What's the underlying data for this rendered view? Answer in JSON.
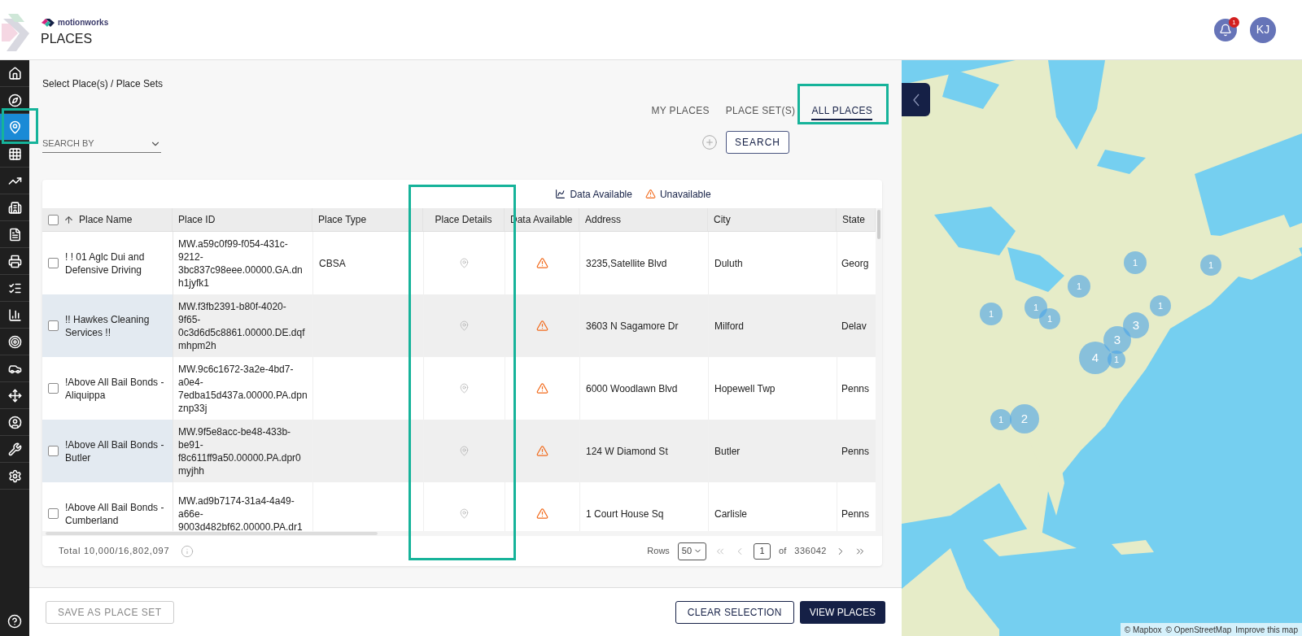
{
  "header": {
    "brand": "motionworks",
    "title": "PLACES",
    "notification_count": "1",
    "avatar_initials": "KJ"
  },
  "sidebar": {
    "items": [
      {
        "selected": false
      },
      {
        "selected": false
      },
      {
        "selected": true
      },
      {
        "selected": false
      },
      {
        "selected": false
      },
      {
        "selected": false
      },
      {
        "selected": false
      },
      {
        "selected": false
      },
      {
        "selected": false
      },
      {
        "selected": false
      },
      {
        "selected": false
      },
      {
        "selected": false
      },
      {
        "selected": false
      },
      {
        "selected": false
      },
      {
        "selected": false
      },
      {
        "selected": false
      }
    ]
  },
  "breadcrumb": "Select Place(s) / Place Sets",
  "tabs": [
    {
      "label": "MY PLACES",
      "selected": false
    },
    {
      "label": "PLACE SET(S)",
      "selected": false
    },
    {
      "label": "ALL PLACES",
      "selected": true
    }
  ],
  "search_by": {
    "label": "SEARCH BY"
  },
  "search_button": "SEARCH",
  "legend": {
    "available": "Data Available",
    "unavailable": "Unavailable"
  },
  "table": {
    "select_all_checked": false,
    "columns": [
      "Place Name",
      "Place ID",
      "Place Type",
      "Place Details",
      "Data Available",
      "Address",
      "City",
      "State"
    ],
    "rows": [
      {
        "checked": false,
        "place_name": "! ! 01 Aglc Dui and Defensive Driving",
        "place_id": "MW.a59c0f99-f054-431c-9212-3bc837c98eee.00000.GA.dnh1jyfk1",
        "place_type": "CBSA",
        "data_available": false,
        "address": "3235,Satellite Blvd",
        "city": "Duluth",
        "state": "Georg"
      },
      {
        "checked": false,
        "place_name": "!! Hawkes Cleaning Services !!",
        "place_id": "MW.f3fb2391-b80f-4020-9f65-0c3d6d5c8861.00000.DE.dqfmhpm2h",
        "place_type": "",
        "data_available": false,
        "address": "3603 N Sagamore Dr",
        "city": "Milford",
        "state": "Delav"
      },
      {
        "checked": false,
        "place_name": "!Above All Bail Bonds - Aliquippa",
        "place_id": "MW.9c6c1672-3a2e-4bd7-a0e4-7edba15d437a.00000.PA.dpnznp33j",
        "place_type": "",
        "data_available": false,
        "address": "6000 Woodlawn Blvd",
        "city": "Hopewell Twp",
        "state": "Penns"
      },
      {
        "checked": false,
        "place_name": "!Above All Bail Bonds - Butler",
        "place_id": "MW.9f5e8acc-be48-433b-be91-f8c611ff9a50.00000.PA.dpr0myjhh",
        "place_type": "",
        "data_available": false,
        "address": "124 W Diamond St",
        "city": "Butler",
        "state": "Penns"
      },
      {
        "checked": false,
        "place_name": "!Above All Bail Bonds - Cumberland",
        "place_id": "MW.ad9b7174-31a4-4a49-a66e-9003d482bf62.00000.PA.dr1",
        "place_type": "",
        "data_available": false,
        "address": "1 Court House Sq",
        "city": "Carlisle",
        "state": "Penns"
      }
    ]
  },
  "footer": {
    "total": "Total 10,000/16,802,097",
    "rows_label": "Rows",
    "rows_per_page": "50",
    "page": "1",
    "of": "of",
    "page_count": "336042"
  },
  "actions": {
    "save": {
      "label": "SAVE AS PLACE SET",
      "disabled": true
    },
    "clear": "CLEAR SELECTION",
    "view": "VIEW PLACES"
  },
  "map": {
    "clusters": [
      {
        "count": "1"
      },
      {
        "count": "1"
      },
      {
        "count": "1"
      },
      {
        "count": "1"
      },
      {
        "count": "1"
      },
      {
        "count": "1"
      },
      {
        "count": "1"
      },
      {
        "count": "3"
      },
      {
        "count": "3"
      },
      {
        "count": "4"
      },
      {
        "count": "1"
      },
      {
        "count": "1"
      },
      {
        "count": "2"
      }
    ],
    "attribution": [
      "© Mapbox",
      "© OpenStreetMap",
      "Improve this map"
    ]
  }
}
